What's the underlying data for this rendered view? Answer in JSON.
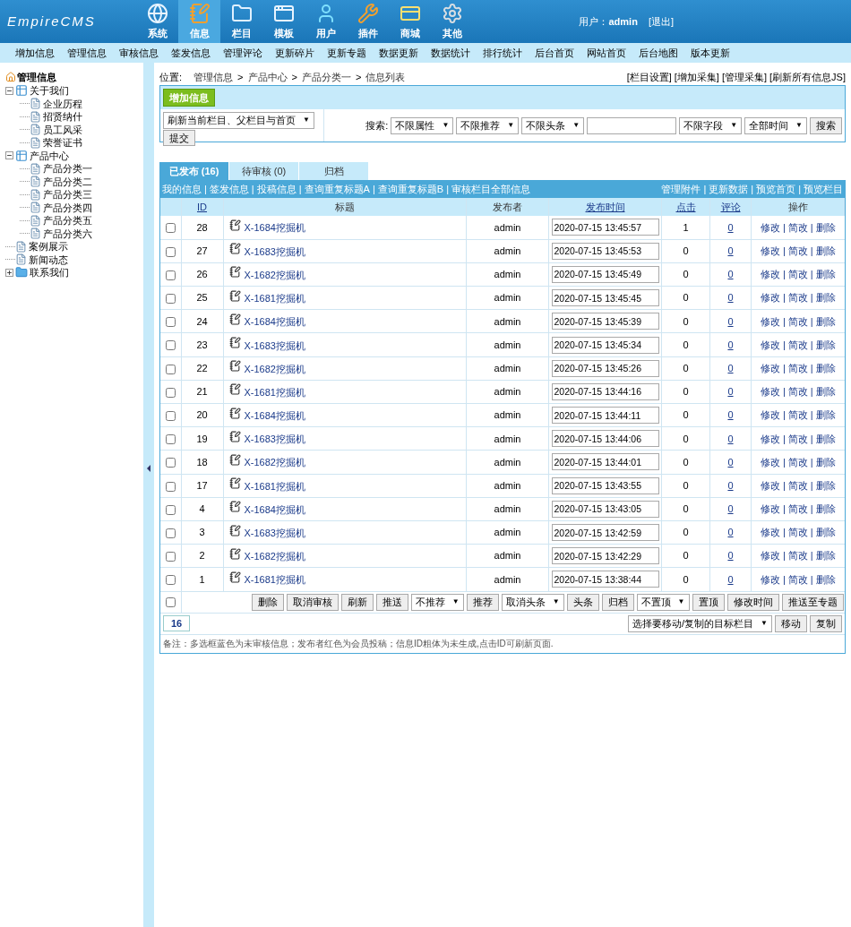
{
  "logo": "EmpireCMS",
  "caret": "▼",
  "separator": "|",
  "main_nav": [
    {
      "label": "系统",
      "selected": false
    },
    {
      "label": "信息",
      "selected": true
    },
    {
      "label": "栏目",
      "selected": false
    },
    {
      "label": "模板",
      "selected": false
    },
    {
      "label": "用户",
      "selected": false
    },
    {
      "label": "插件",
      "selected": false
    },
    {
      "label": "商城",
      "selected": false
    },
    {
      "label": "其他",
      "selected": false
    }
  ],
  "user": {
    "label": "用户：",
    "name": "admin",
    "logout": "[退出]"
  },
  "sub_nav": [
    "增加信息",
    "管理信息",
    "审核信息",
    "签发信息",
    "管理评论",
    "更新碎片",
    "更新专题",
    "数据更新",
    "数据统计",
    "排行统计",
    "后台首页",
    "网站首页",
    "后台地图",
    "版本更新"
  ],
  "tree": {
    "title": "管理信息",
    "items": [
      {
        "label": "关于我们",
        "expanded": true,
        "children": [
          {
            "label": "企业历程"
          },
          {
            "label": "招贤纳什"
          },
          {
            "label": "员工风采"
          },
          {
            "label": "荣誉证书"
          }
        ]
      },
      {
        "label": "产品中心",
        "expanded": true,
        "children": [
          {
            "label": "产品分类一"
          },
          {
            "label": "产品分类二"
          },
          {
            "label": "产品分类三"
          },
          {
            "label": "产品分类四"
          },
          {
            "label": "产品分类五"
          },
          {
            "label": "产品分类六"
          }
        ]
      },
      {
        "label": "案例展示"
      },
      {
        "label": "新闻动态"
      },
      {
        "label": "联系我们",
        "expanded": false
      }
    ]
  },
  "breadcrumb": {
    "label": "位置:",
    "path": [
      "管理信息",
      "产品中心",
      "产品分类一",
      "信息列表"
    ],
    "separator": ">"
  },
  "top_links": [
    "[栏目设置]",
    "[增加采集]",
    "[管理采集]",
    "[刷新所有信息JS]"
  ],
  "add_button": "增加信息",
  "refresh_select": "刷新当前栏目、父栏目与首页",
  "submit_button": "提交",
  "search": {
    "label": "搜索:",
    "selects_before": [
      "不限属性",
      "不限推荐",
      "不限头条"
    ],
    "selects_after": [
      "不限字段",
      "全部时间"
    ],
    "button": "搜索"
  },
  "tabs": [
    {
      "label": "已发布 (16)",
      "selected": true
    },
    {
      "label": "待审核 (0)",
      "selected": false
    },
    {
      "label": "归档",
      "selected": false
    }
  ],
  "links_left": [
    "我的信息",
    "签发信息",
    "投稿信息",
    "查询重复标题A",
    "查询重复标题B",
    "审核栏目全部信息"
  ],
  "links_right": [
    "管理附件",
    "更新数据",
    "预览首页",
    "预览栏目"
  ],
  "columns": [
    {
      "label": "ID",
      "kind": "link"
    },
    {
      "label": "标题",
      "kind": "text"
    },
    {
      "label": "发布者",
      "kind": "text"
    },
    {
      "label": "发布时间",
      "kind": "link"
    },
    {
      "label": "点击",
      "kind": "link"
    },
    {
      "label": "评论",
      "kind": "link"
    },
    {
      "label": "操作",
      "kind": "text"
    }
  ],
  "rows": [
    {
      "checked": false,
      "id": "28",
      "title": "X-1684挖掘机",
      "publisher": "admin",
      "time": "2020-07-15 13:45:57",
      "clicks": "1",
      "comments": "0",
      "actions": [
        "修改",
        "简改",
        "删除"
      ]
    },
    {
      "checked": false,
      "id": "27",
      "title": "X-1683挖掘机",
      "publisher": "admin",
      "time": "2020-07-15 13:45:53",
      "clicks": "0",
      "comments": "0",
      "actions": [
        "修改",
        "简改",
        "删除"
      ]
    },
    {
      "checked": false,
      "id": "26",
      "title": "X-1682挖掘机",
      "publisher": "admin",
      "time": "2020-07-15 13:45:49",
      "clicks": "0",
      "comments": "0",
      "actions": [
        "修改",
        "简改",
        "删除"
      ]
    },
    {
      "checked": false,
      "id": "25",
      "title": "X-1681挖掘机",
      "publisher": "admin",
      "time": "2020-07-15 13:45:45",
      "clicks": "0",
      "comments": "0",
      "actions": [
        "修改",
        "简改",
        "删除"
      ]
    },
    {
      "checked": false,
      "id": "24",
      "title": "X-1684挖掘机",
      "publisher": "admin",
      "time": "2020-07-15 13:45:39",
      "clicks": "0",
      "comments": "0",
      "actions": [
        "修改",
        "简改",
        "删除"
      ]
    },
    {
      "checked": false,
      "id": "23",
      "title": "X-1683挖掘机",
      "publisher": "admin",
      "time": "2020-07-15 13:45:34",
      "clicks": "0",
      "comments": "0",
      "actions": [
        "修改",
        "简改",
        "删除"
      ]
    },
    {
      "checked": false,
      "id": "22",
      "title": "X-1682挖掘机",
      "publisher": "admin",
      "time": "2020-07-15 13:45:26",
      "clicks": "0",
      "comments": "0",
      "actions": [
        "修改",
        "简改",
        "删除"
      ]
    },
    {
      "checked": false,
      "id": "21",
      "title": "X-1681挖掘机",
      "publisher": "admin",
      "time": "2020-07-15 13:44:16",
      "clicks": "0",
      "comments": "0",
      "actions": [
        "修改",
        "简改",
        "删除"
      ]
    },
    {
      "checked": false,
      "id": "20",
      "title": "X-1684挖掘机",
      "publisher": "admin",
      "time": "2020-07-15 13:44:11",
      "clicks": "0",
      "comments": "0",
      "actions": [
        "修改",
        "简改",
        "删除"
      ]
    },
    {
      "checked": false,
      "id": "19",
      "title": "X-1683挖掘机",
      "publisher": "admin",
      "time": "2020-07-15 13:44:06",
      "clicks": "0",
      "comments": "0",
      "actions": [
        "修改",
        "简改",
        "删除"
      ]
    },
    {
      "checked": false,
      "id": "18",
      "title": "X-1682挖掘机",
      "publisher": "admin",
      "time": "2020-07-15 13:44:01",
      "clicks": "0",
      "comments": "0",
      "actions": [
        "修改",
        "简改",
        "删除"
      ]
    },
    {
      "checked": false,
      "id": "17",
      "title": "X-1681挖掘机",
      "publisher": "admin",
      "time": "2020-07-15 13:43:55",
      "clicks": "0",
      "comments": "0",
      "actions": [
        "修改",
        "简改",
        "删除"
      ]
    },
    {
      "checked": false,
      "id": "4",
      "title": "X-1684挖掘机",
      "publisher": "admin",
      "time": "2020-07-15 13:43:05",
      "clicks": "0",
      "comments": "0",
      "actions": [
        "修改",
        "简改",
        "删除"
      ]
    },
    {
      "checked": false,
      "id": "3",
      "title": "X-1683挖掘机",
      "publisher": "admin",
      "time": "2020-07-15 13:42:59",
      "clicks": "0",
      "comments": "0",
      "actions": [
        "修改",
        "简改",
        "删除"
      ]
    },
    {
      "checked": false,
      "id": "2",
      "title": "X-1682挖掘机",
      "publisher": "admin",
      "time": "2020-07-15 13:42:29",
      "clicks": "0",
      "comments": "0",
      "actions": [
        "修改",
        "简改",
        "删除"
      ]
    },
    {
      "checked": false,
      "id": "1",
      "title": "X-1681挖掘机",
      "publisher": "admin",
      "time": "2020-07-15 13:38:44",
      "clicks": "0",
      "comments": "0",
      "actions": [
        "修改",
        "简改",
        "删除"
      ]
    }
  ],
  "select_all": {
    "checked": false
  },
  "bulk_actions": [
    {
      "kind": "button",
      "label": "删除"
    },
    {
      "kind": "button",
      "label": "取消审核"
    },
    {
      "kind": "button",
      "label": "刷新"
    },
    {
      "kind": "button",
      "label": "推送"
    },
    {
      "kind": "select",
      "label": "不推荐"
    },
    {
      "kind": "button",
      "label": "推荐"
    },
    {
      "kind": "select",
      "label": "取消头条"
    },
    {
      "kind": "button",
      "label": "头条"
    },
    {
      "kind": "button",
      "label": "归档"
    },
    {
      "kind": "select",
      "label": "不置顶"
    },
    {
      "kind": "button",
      "label": "置顶"
    },
    {
      "kind": "button",
      "label": "修改时间"
    },
    {
      "kind": "button",
      "label": "推送至专题"
    }
  ],
  "page_number": "16",
  "move_select": "选择要移动/复制的目标栏目",
  "move_buttons": [
    "移动",
    "复制"
  ],
  "note": "备注：多选框蓝色为未审核信息；发布者红色为会员投稿；信息ID粗体为未生成,点击ID可刷新页面."
}
